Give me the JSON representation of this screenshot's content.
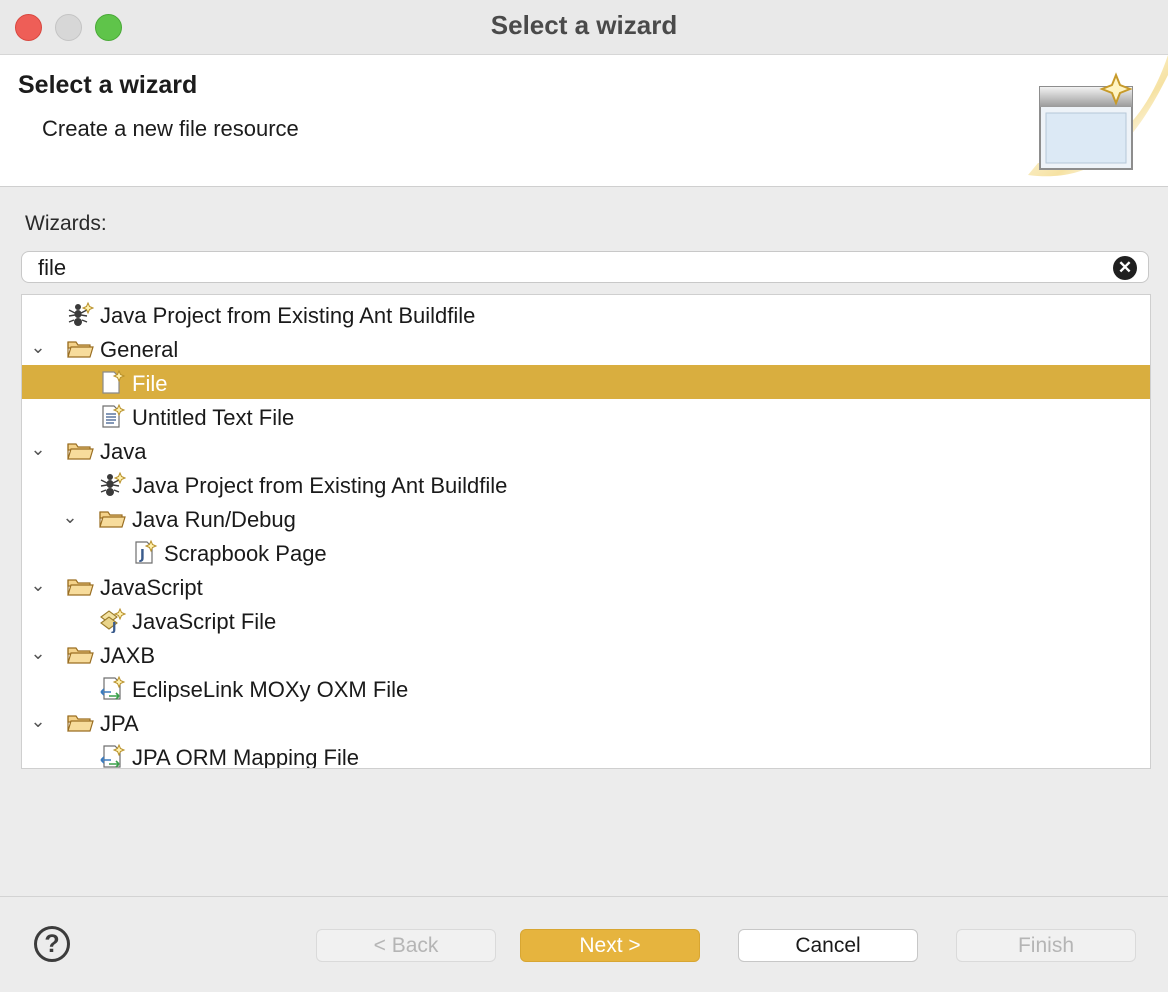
{
  "window": {
    "title": "Select a wizard"
  },
  "banner": {
    "heading": "Select a wizard",
    "subheading": "Create a new file resource"
  },
  "wizards": {
    "label": "Wizards:",
    "filter_value": "file",
    "tree": [
      {
        "label": "Java Project from Existing Ant Buildfile",
        "icon": "ant-project-icon",
        "depth": 0,
        "expandable": false
      },
      {
        "label": "General",
        "icon": "folder-open-icon",
        "depth": 0,
        "expandable": true,
        "expanded": true
      },
      {
        "label": "File",
        "icon": "new-file-icon",
        "depth": 1,
        "expandable": false,
        "selected": true
      },
      {
        "label": "Untitled Text File",
        "icon": "text-file-icon",
        "depth": 1,
        "expandable": false
      },
      {
        "label": "Java",
        "icon": "folder-open-icon",
        "depth": 0,
        "expandable": true,
        "expanded": true
      },
      {
        "label": "Java Project from Existing Ant Buildfile",
        "icon": "ant-project-icon",
        "depth": 1,
        "expandable": false
      },
      {
        "label": "Java Run/Debug",
        "icon": "folder-open-icon",
        "depth": 1,
        "expandable": true,
        "expanded": true
      },
      {
        "label": "Scrapbook Page",
        "icon": "scrapbook-icon",
        "depth": 2,
        "expandable": false
      },
      {
        "label": "JavaScript",
        "icon": "folder-open-icon",
        "depth": 0,
        "expandable": true,
        "expanded": true
      },
      {
        "label": "JavaScript File",
        "icon": "javascript-file-icon",
        "depth": 1,
        "expandable": false
      },
      {
        "label": "JAXB",
        "icon": "folder-open-icon",
        "depth": 0,
        "expandable": true,
        "expanded": true
      },
      {
        "label": "EclipseLink MOXy OXM File",
        "icon": "mapping-file-icon",
        "depth": 1,
        "expandable": false
      },
      {
        "label": "JPA",
        "icon": "folder-open-icon",
        "depth": 0,
        "expandable": true,
        "expanded": true
      },
      {
        "label": "JPA ORM Mapping File",
        "icon": "mapping-file-icon",
        "depth": 1,
        "expandable": false
      }
    ]
  },
  "footer": {
    "help_glyph": "?",
    "back_label": "< Back",
    "next_label": "Next >",
    "cancel_label": "Cancel",
    "finish_label": "Finish"
  },
  "colors": {
    "selection": "#d9ae3f",
    "primary_button": "#e6b43e",
    "folder": "#e8b55a"
  }
}
